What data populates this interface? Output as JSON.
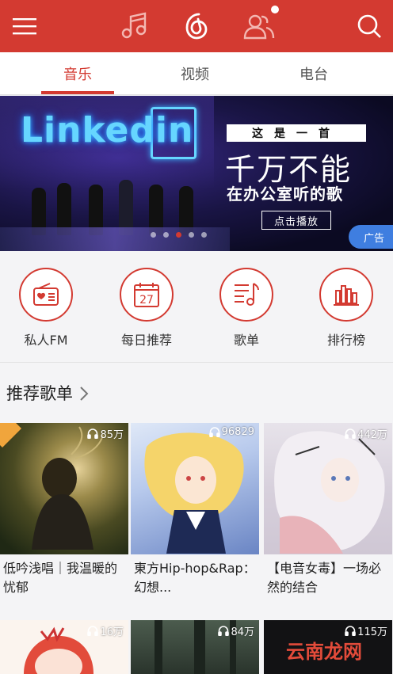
{
  "topbar": {
    "icons": [
      "menu-icon",
      "music-note-icon",
      "netease-logo-icon",
      "friends-icon",
      "search-icon"
    ],
    "accent": "#d33a31"
  },
  "tabs": [
    {
      "label": "音乐",
      "active": true
    },
    {
      "label": "视频",
      "active": false
    },
    {
      "label": "电台",
      "active": false
    }
  ],
  "banner": {
    "neon_text": "Linkedin",
    "box_title": "这是一首",
    "big_text": "千万不能",
    "sub_text": "在办公室听的歌",
    "button_label": "点击播放",
    "ad_label": "广告",
    "page_count": 5,
    "active_page": 3
  },
  "quick": [
    {
      "label": "私人FM",
      "icon": "radio-icon"
    },
    {
      "label": "每日推荐",
      "icon": "calendar-icon",
      "day": "27"
    },
    {
      "label": "歌单",
      "icon": "playlist-icon"
    },
    {
      "label": "排行榜",
      "icon": "chart-icon"
    }
  ],
  "section": {
    "title": "推荐歌单"
  },
  "playlists": [
    {
      "count": "85万",
      "title": "低吟浅唱｜我温暖的忧郁",
      "icon": "headphones-icon"
    },
    {
      "count": "96829",
      "title": "東方Hip-hop&Rap：幻想...",
      "icon": "headphones-icon"
    },
    {
      "count": "442万",
      "title": "【电音女毒】一场必然的结合",
      "icon": "headphones-icon"
    },
    {
      "count": "16万",
      "title": "",
      "icon": "headphones-icon"
    },
    {
      "count": "84万",
      "title": "",
      "icon": "headphones-icon"
    },
    {
      "count": "115万",
      "title": "",
      "icon": "headphones-icon",
      "watermark": "云南龙网"
    }
  ]
}
